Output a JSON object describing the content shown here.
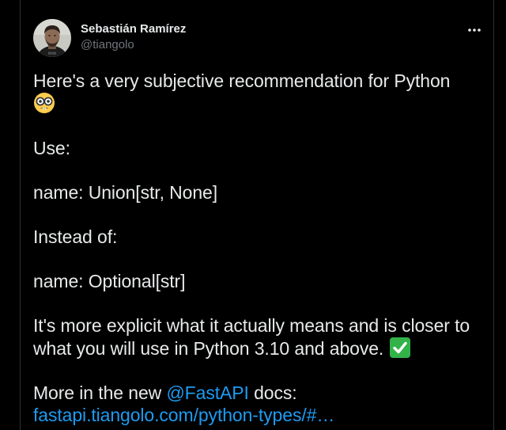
{
  "author": {
    "display_name": "Sebastián Ramírez",
    "handle": "@tiangolo"
  },
  "tweet": {
    "line1": "Here's a very subjective recommendation for Python",
    "emoji1": "nerd-face",
    "use_label": "Use:",
    "code_union": "name: Union[str, None]",
    "instead_label": "Instead of:",
    "code_optional": "name: Optional[str]",
    "explain_line1": "It's more explicit what it actually means and is closer to",
    "explain_line2": "what you will use in Python 3.10 and above.",
    "emoji2": "check-mark-button",
    "more_prefix": "More in the new",
    "mention": "@FastAPI",
    "more_suffix": "docs:",
    "url": "fastapi.tiangolo.com/python-types/#…"
  },
  "colors": {
    "background": "#000000",
    "text": "#e7e9ea",
    "secondary": "#71767b",
    "link": "#1d9bf0",
    "check": "#33b249"
  }
}
